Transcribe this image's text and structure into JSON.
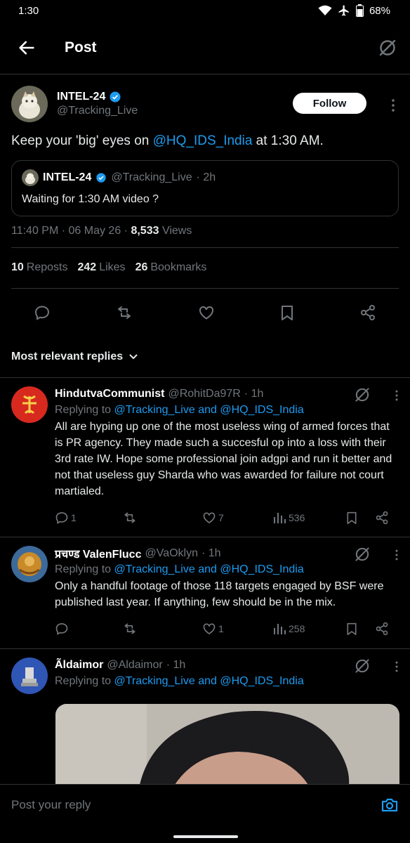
{
  "status": {
    "time": "1:30",
    "battery": "68%"
  },
  "header": {
    "title": "Post"
  },
  "post": {
    "author_name": "INTEL-24",
    "author_handle": "@Tracking_Live",
    "follow_label": "Follow",
    "text_before": "Keep your 'big' eyes on ",
    "text_mention": "@HQ_IDS_India",
    "text_after": " at 1:30 AM.",
    "quote": {
      "name": "INTEL-24",
      "handle": "@Tracking_Live",
      "time": "· 2h",
      "text": "Waiting for 1:30 AM video ?"
    },
    "timestamp": "11:40 PM · 06 May 26 · ",
    "views_count": "8,533",
    "views_label": " Views",
    "reposts_count": "10",
    "reposts_label": "Reposts",
    "likes_count": "242",
    "likes_label": "Likes",
    "bookmarks_count": "26",
    "bookmarks_label": "Bookmarks"
  },
  "sort": {
    "label": "Most relevant replies"
  },
  "replies": [
    {
      "name": "HindutvaCommunist",
      "handle": "@RohitDa97R",
      "time": "· 1h",
      "replying_prefix": "Replying to ",
      "replying_to": "@Tracking_Live and @HQ_IDS_India",
      "text": "All are hyping up one of the most useless wing of armed forces that is PR agency. They made such a succesful op into a loss with their 3rd rate IW. Hope some professional join adgpi and run it better and not that useless guy Sharda who was awarded for failure not court martialed.",
      "comments": "1",
      "reposts": "",
      "likes": "7",
      "views": "536"
    },
    {
      "name": "प्रचण्ड ValenFlucc",
      "handle": "@VaOklyn",
      "time": "· 1h",
      "replying_prefix": "Replying to ",
      "replying_to": "@Tracking_Live and @HQ_IDS_India",
      "text": "Only a handful footage of those 118 targets engaged by BSF were published last year. If anything, few  should be in the mix.",
      "comments": "",
      "reposts": "",
      "likes": "1",
      "views": "258"
    },
    {
      "name": "Ãldaimor",
      "handle": "@Aldaimor",
      "time": "· 1h",
      "replying_prefix": "Replying to ",
      "replying_to": "@Tracking_Live and @HQ_IDS_India"
    }
  ],
  "composer": {
    "placeholder": "Post your reply"
  },
  "colors": {
    "accent": "#1d9bf0",
    "background": "#000000",
    "muted": "#71767b"
  },
  "icons": [
    "back-arrow-icon",
    "grok-icon",
    "verified-icon",
    "more-vertical-icon",
    "reply-icon",
    "repost-icon",
    "like-icon",
    "bookmark-icon",
    "share-icon",
    "views-icon",
    "chevron-down-icon",
    "camera-icon",
    "wifi-icon",
    "airplane-icon",
    "battery-icon"
  ]
}
